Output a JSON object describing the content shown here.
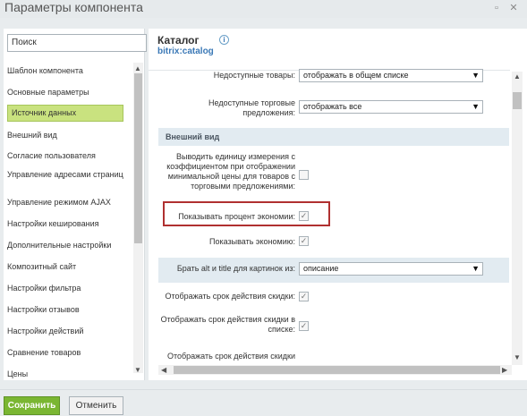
{
  "window": {
    "title": "Параметры компонента",
    "minimize_glyph": "▫",
    "close_glyph": "✕"
  },
  "sidebar": {
    "search_value": "Поиск",
    "items": [
      {
        "label": "Шаблон компонента",
        "active": false
      },
      {
        "label": "Основные параметры",
        "active": false
      },
      {
        "label": "Источник данных",
        "active": true
      },
      {
        "label": "Внешний вид",
        "active": false
      },
      {
        "label": "Согласие пользователя",
        "active": false
      },
      {
        "label": "Управление адресами страниц",
        "active": false
      },
      {
        "label": "Управление режимом AJAX",
        "active": false
      },
      {
        "label": "Настройки кеширования",
        "active": false
      },
      {
        "label": "Дополнительные настройки",
        "active": false
      },
      {
        "label": "Композитный сайт",
        "active": false
      },
      {
        "label": "Настройки фильтра",
        "active": false
      },
      {
        "label": "Настройки отзывов",
        "active": false
      },
      {
        "label": "Настройки действий",
        "active": false
      },
      {
        "label": "Сравнение товаров",
        "active": false
      },
      {
        "label": "Цены",
        "active": false
      }
    ],
    "arrow_up": "▲",
    "arrow_down": "▼"
  },
  "component": {
    "title": "Каталог",
    "code": "bitrix:catalog",
    "info_glyph": "i"
  },
  "form": {
    "unavailable_goods_label": "Недоступные товары:",
    "unavailable_goods_value": "отображать в общем списке",
    "unavailable_offers_label": "Недоступные торговые предложения:",
    "unavailable_offers_value": "отображать все",
    "section_appearance": "Внешний вид",
    "show_unit_label": "Выводить единицу измерения с коэффициентом при отображении минимальной цены для товаров с торговыми предложениями:",
    "show_discount_percent_label": "Показывать процент экономии:",
    "show_discount_label": "Показывать экономию:",
    "alt_title_label": "Брать alt и title для картинок из:",
    "alt_title_value": "описание",
    "show_discount_term_label": "Отображать срок действия скидки:",
    "show_discount_term_list_label": "Отображать срок действия скидки в списке:",
    "show_discount_term_partial_label": "Отображать срок действия скидки",
    "check_glyph": "✓",
    "caret_glyph": "▼"
  },
  "scroll": {
    "up": "▲",
    "down": "▼",
    "left": "◀",
    "right": "▶"
  },
  "footer": {
    "save_label": "Сохранить",
    "cancel_label": "Отменить"
  }
}
